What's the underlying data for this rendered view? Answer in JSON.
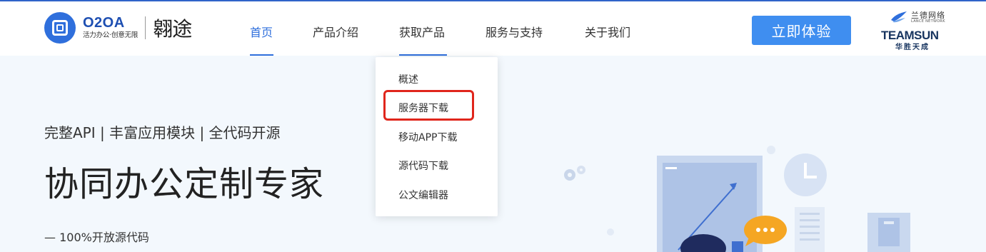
{
  "header": {
    "logo_name": "O2OA",
    "logo_slogan": "活力办公·创意无限",
    "brand": "翱途",
    "cta_label": "立即体验"
  },
  "nav": {
    "items": [
      {
        "label": "首页",
        "active": true
      },
      {
        "label": "产品介绍",
        "active": false
      },
      {
        "label": "获取产品",
        "active": false
      },
      {
        "label": "服务与支持",
        "active": false
      },
      {
        "label": "关于我们",
        "active": false
      }
    ]
  },
  "partner": {
    "lance": "兰德网络",
    "lance_en": "LANCE NETWORK",
    "teamsun": "TEAMSUN",
    "huasheng": "华胜天成"
  },
  "hero": {
    "subtitle": "完整API | 丰富应用模块 | 全代码开源",
    "title": "协同办公定制专家",
    "note": "— 100%开放源代码"
  },
  "dropdown": {
    "items": [
      {
        "label": "概述"
      },
      {
        "label": "服务器下载"
      },
      {
        "label": "移动APP下载"
      },
      {
        "label": "源代码下载"
      },
      {
        "label": "公文编辑器"
      }
    ],
    "highlighted_index": 1
  },
  "colors": {
    "accent": "#2f6fdc",
    "cta": "#3f8ef0",
    "highlight": "#e0261c",
    "background": "#f3f8fd"
  }
}
